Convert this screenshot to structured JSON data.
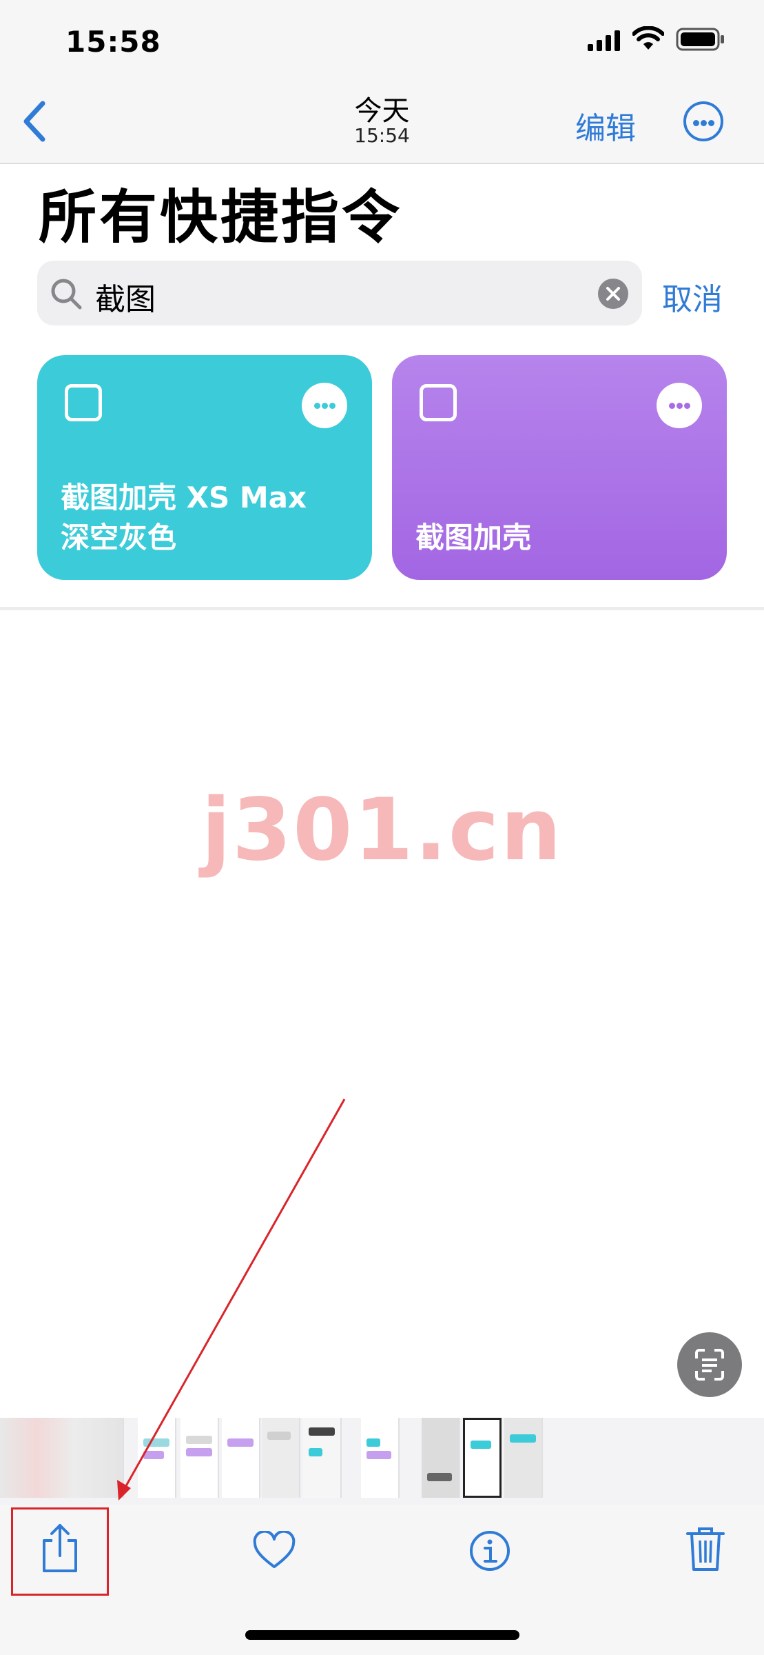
{
  "status_bar": {
    "time": "15:58"
  },
  "nav": {
    "title": "今天",
    "subtitle": "15:54",
    "edit_label": "编辑"
  },
  "page": {
    "title": "所有快捷指令"
  },
  "search": {
    "value": "截图",
    "cancel_label": "取消"
  },
  "shortcuts": [
    {
      "line1": "截图加壳 XS Max",
      "line2": "深空灰色",
      "color": "#3ccbd8"
    },
    {
      "line1": "",
      "line2": "截图加壳",
      "color": "#a86de6"
    }
  ],
  "watermark": "j301.cn",
  "colors": {
    "accent": "#2f7bd6",
    "annotation": "#d9252a"
  },
  "toolbar": {
    "icons": [
      "share-icon",
      "heart-icon",
      "info-icon",
      "trash-icon"
    ]
  }
}
